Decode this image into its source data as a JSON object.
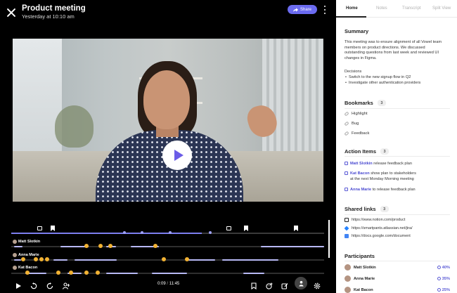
{
  "header": {
    "title": "Product meeting",
    "subtitle": "Yesterday at 10:10 am",
    "share_label": "Share"
  },
  "player": {
    "current_time": "0:09",
    "separator": "/",
    "duration": "11:45",
    "progress_fraction": 0.61
  },
  "timeline": {
    "speakers": [
      {
        "name": "Matt Slotkin"
      },
      {
        "name": "Anna Marie"
      },
      {
        "name": "Kat Bacon"
      }
    ]
  },
  "tabs": [
    {
      "label": "Home",
      "active": true
    },
    {
      "label": "Notes",
      "active": false
    },
    {
      "label": "Transcript",
      "active": false
    },
    {
      "label": "Split View",
      "active": false
    }
  ],
  "summary": {
    "heading": "Summary",
    "lines": [
      "This meeting was to ensure alignment of all Vowel team",
      "members on product directions. We discussed",
      "outstanding questions from last week and reviewed UI",
      "changes in Figma."
    ],
    "decisions_label": "Decisions",
    "decisions": [
      "Switch to the new signup flow in Q2",
      "Investigate other authentication providers"
    ]
  },
  "bookmarks": {
    "heading": "Bookmarks",
    "count": "3",
    "items": [
      "Highlight",
      "Bug",
      "Feedback"
    ]
  },
  "action_items": {
    "heading": "Action Items",
    "count": "3",
    "items": [
      {
        "who": "Matt Slotkin",
        "text": " release feedback plan",
        "line2": ""
      },
      {
        "who": "Kat Bacon",
        "text": " show plan to stakeholders",
        "line2": "at the next Monday Morning meeting"
      },
      {
        "who": "Anna Marie",
        "text": " to release feedback plan",
        "line2": ""
      }
    ]
  },
  "shared_links": {
    "heading": "Shared links",
    "count": "3",
    "items": [
      {
        "url": "https://www.notion.com/product",
        "icon": "notion-icon",
        "color": "#222222"
      },
      {
        "url": "https://smartpants.atlassian.net/jira/",
        "icon": "jira-icon",
        "color": "#2684ff"
      },
      {
        "url": "https://docs.google.com/document",
        "icon": "google-docs-icon",
        "color": "#4285f4"
      }
    ]
  },
  "participants": {
    "heading": "Participants",
    "items": [
      {
        "name": "Matt Slotkin",
        "percent": "40%"
      },
      {
        "name": "Anna Marie",
        "percent": "35%"
      },
      {
        "name": "Kat Bacon",
        "percent": "25%"
      }
    ]
  },
  "colors": {
    "accent": "#6b6bf0",
    "link": "#4b4bd1"
  }
}
